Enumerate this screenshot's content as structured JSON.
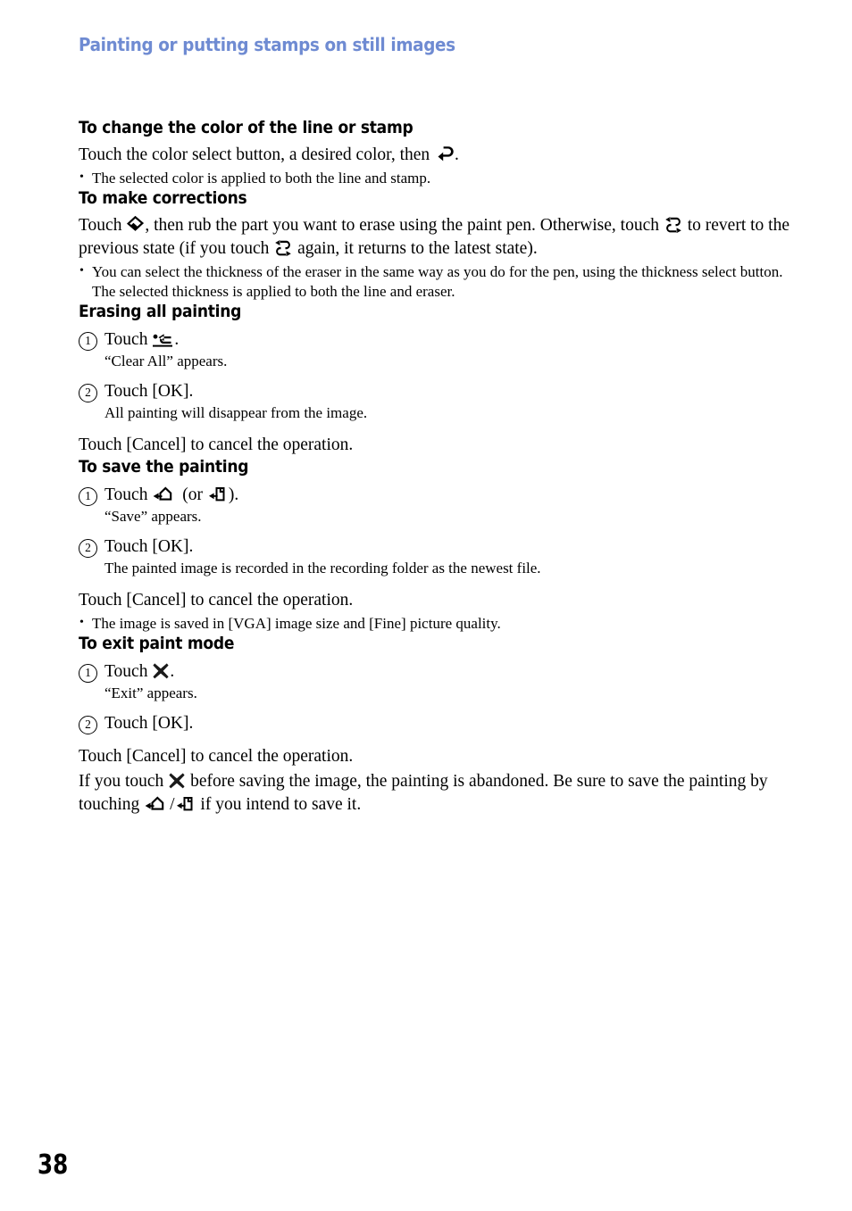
{
  "header": {
    "running_title": "Painting or putting stamps on still images",
    "color": "#6f8bd2"
  },
  "page": {
    "number": "38"
  },
  "sections": [
    {
      "id": "change-color",
      "heading": "To change the color of the line or stamp",
      "body_before_icon": "Touch the color select button, a desired color, then ",
      "body_after_icon": ".",
      "icon": "return-arrow-icon",
      "bullets": [
        "The selected color is applied to both the line and stamp."
      ]
    },
    {
      "id": "make-corrections",
      "heading": "To make corrections",
      "para_part1": "Touch ",
      "para_part2": ", then rub the part you want to erase using the paint pen. Otherwise, touch ",
      "para_part3": " to revert to the previous state (if you touch ",
      "para_part4": " again, it returns to the latest state).",
      "icons": [
        "eraser-icon",
        "undo-redo-icon",
        "undo-redo-icon"
      ],
      "bullets": [
        "You can select the thickness of the eraser in the same way as you do for the pen, using the thickness select button. The selected thickness is applied to both the line and eraser."
      ]
    },
    {
      "id": "erasing-all",
      "heading": "Erasing all painting",
      "steps": [
        {
          "num": "1",
          "text_before": "Touch ",
          "icon": "clear-all-icon",
          "text_after": ".",
          "sub": "“Clear All” appears."
        },
        {
          "num": "2",
          "text_before": "Touch [OK].",
          "icon": "",
          "text_after": "",
          "sub": "All painting will disappear from the image."
        }
      ],
      "after": "Touch [Cancel] to cancel the operation."
    },
    {
      "id": "save-painting",
      "heading": "To save the painting",
      "steps": [
        {
          "num": "1",
          "text_before": "Touch ",
          "icon": "save-folder-icon",
          "text_mid": " (or ",
          "icon2": "save-card-icon",
          "text_after": ").",
          "sub": "“Save” appears."
        },
        {
          "num": "2",
          "text_before": "Touch [OK].",
          "icon": "",
          "text_after": "",
          "sub": "The painted image is recorded in the recording folder as the newest file."
        }
      ],
      "after": "Touch [Cancel] to cancel the operation.",
      "bullets": [
        "The image is saved in [VGA] image size and [Fine] picture quality."
      ]
    },
    {
      "id": "exit-paint-mode",
      "heading": "To exit paint mode",
      "steps": [
        {
          "num": "1",
          "text_before": "Touch ",
          "icon": "exit-cross-icon",
          "text_after": ".",
          "sub": "“Exit” appears."
        },
        {
          "num": "2",
          "text_before": "Touch [OK].",
          "icon": "",
          "text_after": "",
          "sub": ""
        }
      ],
      "after": "Touch [Cancel] to cancel the operation.",
      "final_part1": "If you touch ",
      "final_part2": " before saving the image, the painting is abandoned. Be sure to save the painting by touching ",
      "final_slash": "/",
      "final_part3": " if you intend to save it."
    }
  ]
}
